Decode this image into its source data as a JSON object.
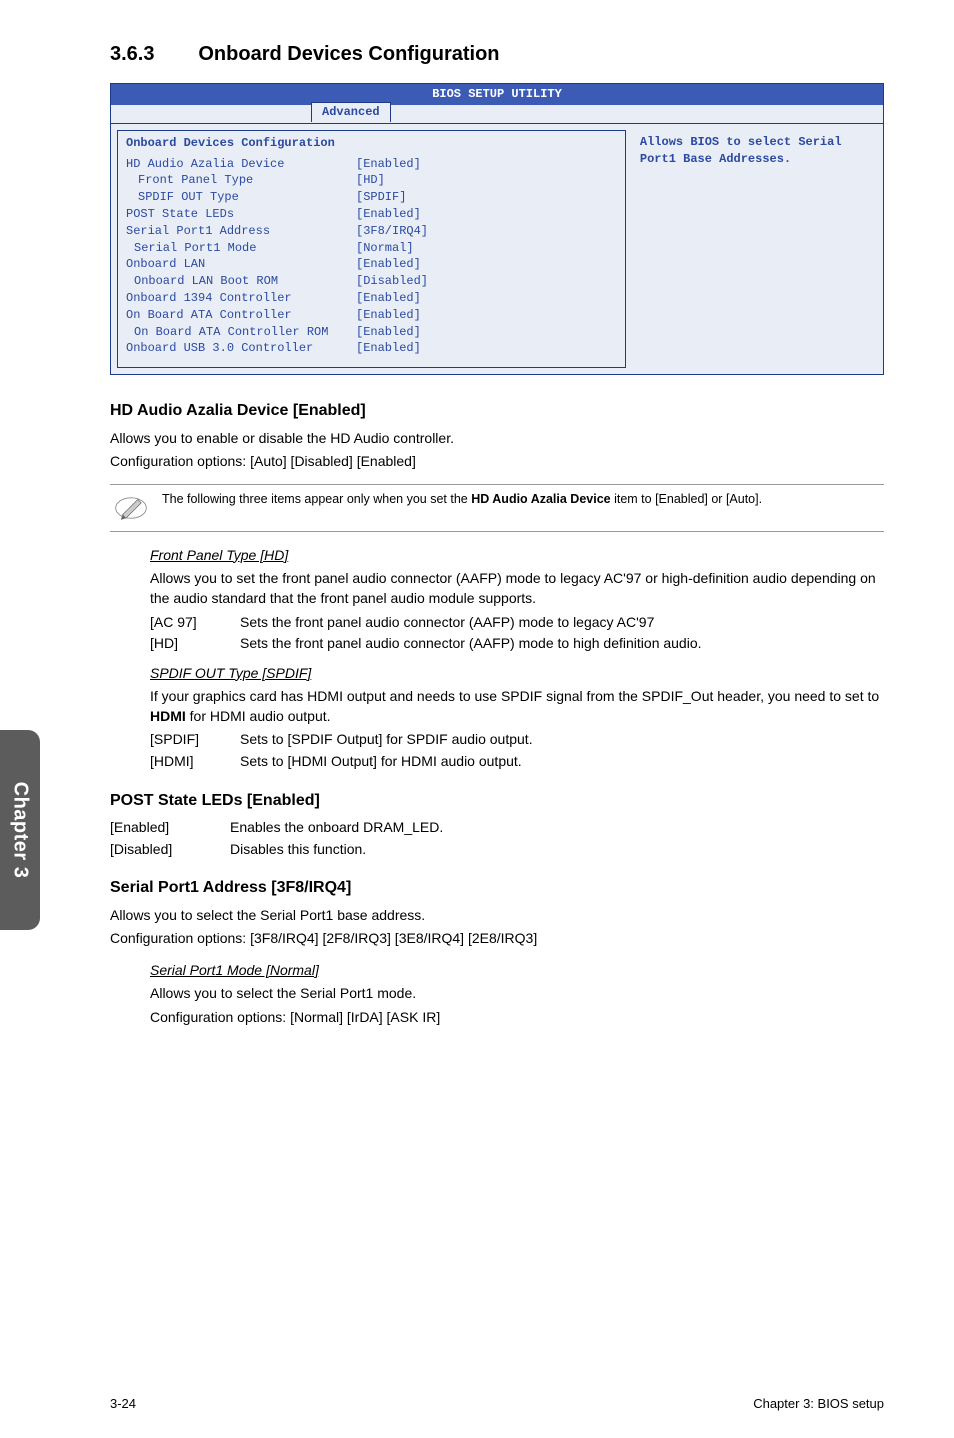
{
  "section": {
    "number": "3.6.3",
    "title": "Onboard Devices Configuration"
  },
  "bios": {
    "header": "BIOS SETUP UTILITY",
    "tab": "Advanced",
    "panel_title": "Onboard Devices Configuration",
    "items": [
      {
        "label": "HD Audio Azalia Device",
        "value": "[Enabled]",
        "indent": ""
      },
      {
        "label": "Front Panel Type",
        "value": "[HD]",
        "indent": "indent1"
      },
      {
        "label": "SPDIF OUT Type",
        "value": "[SPDIF]",
        "indent": "indent1"
      },
      {
        "label": "POST State LEDs",
        "value": "[Enabled]",
        "indent": ""
      },
      {
        "label": "Serial Port1 Address",
        "value": "[3F8/IRQ4]",
        "indent": ""
      },
      {
        "label": "Serial Port1 Mode",
        "value": "[Normal]",
        "indent": "indent2"
      },
      {
        "label": "Onboard LAN",
        "value": "[Enabled]",
        "indent": ""
      },
      {
        "label": "Onboard LAN Boot ROM",
        "value": "[Disabled]",
        "indent": "indent2"
      },
      {
        "label": "Onboard 1394 Controller",
        "value": "[Enabled]",
        "indent": ""
      },
      {
        "label": "On Board ATA Controller",
        "value": "[Enabled]",
        "indent": ""
      },
      {
        "label": "On Board ATA Controller ROM",
        "value": "[Enabled]",
        "indent": "indent2"
      },
      {
        "label": "Onboard USB 3.0 Controller",
        "value": "[Enabled]",
        "indent": ""
      }
    ],
    "help": "Allows BIOS to select Serial Port1 Base Addresses."
  },
  "hd_audio": {
    "heading": "HD Audio Azalia Device [Enabled]",
    "p1": "Allows you to enable or disable the HD Audio controller.",
    "p2": "Configuration options: [Auto] [Disabled] [Enabled]"
  },
  "note": {
    "text_a": "The following three items appear only when you set the ",
    "text_bold": "HD Audio Azalia Device",
    "text_b": " item to [Enabled] or [Auto]."
  },
  "front_panel": {
    "title": "Front Panel Type [HD]",
    "desc": "Allows you to set the front panel audio connector (AAFP) mode to legacy AC'97 or high-definition audio depending on the audio standard that the front panel audio module supports.",
    "opts": [
      {
        "key": "[AC 97]",
        "val": "Sets the front panel audio connector (AAFP) mode to legacy AC'97"
      },
      {
        "key": "[HD]",
        "val": "Sets the front panel audio connector (AAFP) mode to high definition audio."
      }
    ]
  },
  "spdif": {
    "title": "SPDIF OUT Type [SPDIF]",
    "desc_a": "If your graphics card has HDMI output and needs to use SPDIF signal from the SPDIF_Out header, you need to set to ",
    "desc_bold": "HDMI",
    "desc_b": " for HDMI audio output.",
    "opts": [
      {
        "key": "[SPDIF]",
        "val": "Sets to [SPDIF Output] for SPDIF audio output."
      },
      {
        "key": "[HDMI]",
        "val": "Sets to [HDMI Output] for HDMI audio output."
      }
    ]
  },
  "post_leds": {
    "heading": "POST State LEDs [Enabled]",
    "opts": [
      {
        "key": "[Enabled]",
        "val": "Enables the onboard DRAM_LED."
      },
      {
        "key": "[Disabled]",
        "val": "Disables this function."
      }
    ]
  },
  "serial_port": {
    "heading": "Serial Port1 Address [3F8/IRQ4]",
    "p1": "Allows you to select the Serial Port1 base address.",
    "p2": "Configuration options: [3F8/IRQ4] [2F8/IRQ3] [3E8/IRQ4] [2E8/IRQ3]"
  },
  "serial_mode": {
    "title": "Serial Port1 Mode [Normal]",
    "p1": "Allows you to select the Serial Port1 mode.",
    "p2": "Configuration options: [Normal] [IrDA] [ASK IR]"
  },
  "side_tab": "Chapter 3",
  "footer": {
    "left": "3-24",
    "right": "Chapter 3: BIOS setup"
  }
}
